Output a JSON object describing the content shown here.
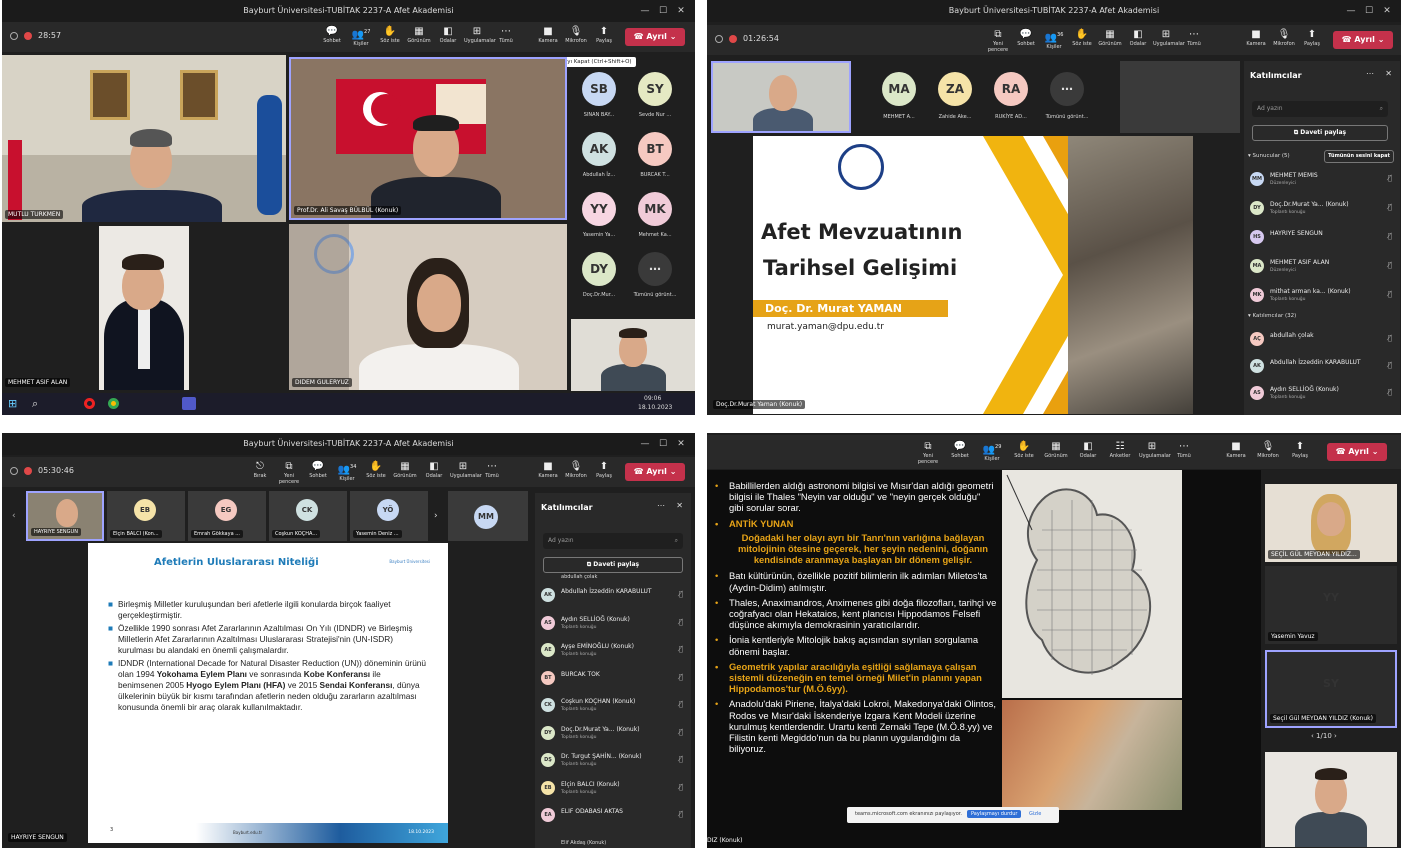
{
  "q1": {
    "title": "Bayburt Üniversitesi-TUBİTAK 2237-A Afet Akademisi",
    "timer": "28:57",
    "toolbar": [
      {
        "icon": "💬",
        "label": "Sohbet"
      },
      {
        "icon": "👥",
        "label": "Kişiler",
        "badge": "27"
      },
      {
        "icon": "✋",
        "label": "Söz iste"
      },
      {
        "icon": "▦",
        "label": "Görünüm"
      },
      {
        "icon": "◧",
        "label": "Odalar"
      },
      {
        "icon": "⊞",
        "label": "Uygulamalar"
      },
      {
        "icon": "⋯",
        "label": "Tümü"
      },
      {
        "icon": "■",
        "label": "Kamera"
      },
      {
        "icon": "🎙",
        "label": "Mikrofon"
      },
      {
        "icon": "⬆",
        "label": "Paylaş"
      }
    ],
    "leave": "Ayrıl",
    "tooltip": "Kamerayı Kapat (Ctrl+Shift+O)",
    "tiles": [
      {
        "name": "MUTLU TURKMEN"
      },
      {
        "name": "Prof.Dr. Ali Savaş BÜLBÜL (Konuk)"
      },
      {
        "name": "MEHMET ASIF ALAN"
      },
      {
        "name": "DIDEM GULERYUZ"
      }
    ],
    "avatars": [
      {
        "initials": "SB",
        "name": "SINAN BAY...",
        "color": "#c7d8f3"
      },
      {
        "initials": "SY",
        "name": "Sevde Nur ...",
        "color": "#e5e9c3"
      },
      {
        "initials": "AK",
        "name": "Abdullah İz...",
        "color": "#cfe1e1"
      },
      {
        "initials": "BT",
        "name": "BURCAK T...",
        "color": "#f5c9c1"
      },
      {
        "initials": "YY",
        "name": "Yasemin Ya...",
        "color": "#f7d6e2"
      },
      {
        "initials": "MK",
        "name": "Mehmet Ka...",
        "color": "#f0cbd8"
      },
      {
        "initials": "DY",
        "name": "Doç.Dr.Mur...",
        "color": "#dbe7c8"
      },
      {
        "initials": "⋯",
        "name": "Tümünü görünt...",
        "color": "#3a3a3a"
      }
    ],
    "taskbar_time": "09:06",
    "taskbar_date": "18.10.2023"
  },
  "q2": {
    "title": "Bayburt Üniversitesi-TUBİTAK 2237-A Afet Akademisi",
    "timer": "01:26:54",
    "toolbar": [
      {
        "icon": "⧉",
        "label": "Yeni pencere"
      },
      {
        "icon": "💬",
        "label": "Sohbet"
      },
      {
        "icon": "👥",
        "label": "Kişiler",
        "badge": "36"
      },
      {
        "icon": "✋",
        "label": "Söz iste"
      },
      {
        "icon": "▦",
        "label": "Görünüm"
      },
      {
        "icon": "◧",
        "label": "Odalar"
      },
      {
        "icon": "⊞",
        "label": "Uygulamalar"
      },
      {
        "icon": "⋯",
        "label": "Tümü"
      },
      {
        "icon": "■",
        "label": "Kamera"
      },
      {
        "icon": "🎙",
        "label": "Mikrofon"
      },
      {
        "icon": "⬆",
        "label": "Paylaş"
      }
    ],
    "leave": "Ayrıl",
    "avatars": [
      {
        "initials": "MA",
        "name": "MEHMET A...",
        "color": "#dbe7c8"
      },
      {
        "initials": "ZA",
        "name": "Zahide Ake...",
        "color": "#f5e3a8"
      },
      {
        "initials": "RA",
        "name": "RUKİYE AD...",
        "color": "#f5c9c1"
      },
      {
        "initials": "⋯",
        "name": "Tümünü görünt...",
        "color": "#3a3a3a"
      }
    ],
    "mm_initials": "MM",
    "slide": {
      "title1": "Afet Mevzuatının",
      "title2": "Tarihsel Gelişimi",
      "author": "Doç. Dr. Murat YAMAN",
      "email": "murat.yaman@dpu.edu.tr"
    },
    "presenter_label": "Doç.Dr.Murat Yaman (Konuk)",
    "panel": {
      "title": "Katılımcılar",
      "search": "Ad yazın",
      "invite": "Daveti paylaş",
      "presenters_label": "Sunucular (5)",
      "mute_all": "Tümünün sesini kapat",
      "presenters": [
        {
          "initials": "MM",
          "name": "MEHMET MEMIS",
          "role": "Düzenleyici",
          "color": "#c7d8f3"
        },
        {
          "initials": "DY",
          "name": "Doç.Dr.Murat Ya... (Konuk)",
          "role": "Toplantı konuğu",
          "color": "#dbe7c8"
        },
        {
          "initials": "HS",
          "name": "HAYRIYE SENGUN",
          "role": "",
          "color": "#d6c8ef"
        },
        {
          "initials": "MA",
          "name": "MEHMET ASIF ALAN",
          "role": "Düzenleyici",
          "color": "#dbe7c8"
        },
        {
          "initials": "MK",
          "name": "mithat arman ka... (Konuk)",
          "role": "Toplantı konuğu",
          "color": "#f0cbd8"
        }
      ],
      "attendees_label": "Katılımcılar (32)",
      "attendees": [
        {
          "initials": "AÇ",
          "name": "abdullah çolak",
          "role": "",
          "color": "#f5c9c1"
        },
        {
          "initials": "AK",
          "name": "Abdullah İzzeddin KARABULUT",
          "role": "",
          "color": "#cfe1e1"
        },
        {
          "initials": "AS",
          "name": "Aydın SELLİOĞ (Konuk)",
          "role": "Toplantı konuğu",
          "color": "#f0cbd8"
        }
      ]
    }
  },
  "q3": {
    "title": "Bayburt Üniversitesi-TUBİTAK 2237-A Afet Akademisi",
    "timer": "05:30:46",
    "toolbar": [
      {
        "icon": "⎋",
        "label": "Bırak"
      },
      {
        "icon": "⧉",
        "label": "Yeni pencere"
      },
      {
        "icon": "💬",
        "label": "Sohbet"
      },
      {
        "icon": "👥",
        "label": "Kişiler",
        "badge": "34"
      },
      {
        "icon": "✋",
        "label": "Söz iste"
      },
      {
        "icon": "▦",
        "label": "Görünüm"
      },
      {
        "icon": "◧",
        "label": "Odalar"
      },
      {
        "icon": "⊞",
        "label": "Uygulamalar"
      },
      {
        "icon": "⋯",
        "label": "Tümü"
      },
      {
        "icon": "■",
        "label": "Kamera"
      },
      {
        "icon": "🎙",
        "label": "Mikrofon"
      },
      {
        "icon": "⬆",
        "label": "Paylaş"
      }
    ],
    "leave": "Ayrıl",
    "strip": [
      {
        "initials": "",
        "name": "HAYRIYE SENGUN",
        "color": ""
      },
      {
        "initials": "EB",
        "name": "Elçin BALCI (Kon...",
        "color": "#f5e3a8"
      },
      {
        "initials": "EG",
        "name": "Emrah Gökkaya ...",
        "color": "#f5c9c1"
      },
      {
        "initials": "CK",
        "name": "Coşkun KOÇHA...",
        "color": "#cfe1e1"
      },
      {
        "initials": "YÖ",
        "name": "Yasemin Deniz ...",
        "color": "#c7d8f3"
      }
    ],
    "mm_initials": "MM",
    "slide": {
      "heading": "Afetlerin Uluslararası Niteliği",
      "logo_text": "Bayburt Üniversitesi",
      "bullets": [
        "Birleşmiş Milletler kuruluşundan beri afetlerle ilgili konularda birçok faaliyet gerçekleştirmiştir.",
        "Özellikle 1990 sonrası Afet Zararlarının Azaltılması On Yılı (IDNDR) ve Birleşmiş Milletlerin Afet Zararlarının Azaltılması Uluslararası Stratejisi'nin (UN-ISDR) kurulması bu alandaki en önemli çalışmalardır."
      ],
      "b3_part1": "IDNDR (International Decade for Natural Disaster Reduction (UN)) döneminin ürünü olan 1994 ",
      "b3_bold1": "Yokohama Eylem Planı",
      "b3_part2": " ve sonrasında ",
      "b3_bold2": "Kobe Konferansı",
      "b3_part3": " ile benimsenen 2005 ",
      "b3_bold3": "Hyogo Eylem Planı (HFA)",
      "b3_part4": " ve 2015 ",
      "b3_bold4": "Sendai Konferansı",
      "b3_part5": ", dünya ülkelerinin büyük bir kısmı tarafından afetlerin neden olduğu zararların azaltılması konusunda önemli bir araç olarak kullanılmaktadır.",
      "page_num": "3",
      "footer_left": "Bayburt.edu.tr",
      "footer_date": "18.10.2023"
    },
    "presenter_label": "HAYRIYE SENGUN",
    "panel": {
      "title": "Katılımcılar",
      "search": "Ad yazın",
      "invite": "Daveti paylaş",
      "cut_top": "abdullah çolak",
      "rows": [
        {
          "initials": "AK",
          "name": "Abdullah İzzeddin KARABULUT",
          "role": "",
          "color": "#cfe1e1"
        },
        {
          "initials": "AS",
          "name": "Aydın SELLİOĞ (Konuk)",
          "role": "Toplantı konuğu",
          "color": "#f0cbd8"
        },
        {
          "initials": "AE",
          "name": "Ayşe EMİNOĞLU (Konuk)",
          "role": "Toplantı konuğu",
          "color": "#dbe7c8"
        },
        {
          "initials": "BT",
          "name": "BURCAK TOK",
          "role": "",
          "color": "#f5c9c1"
        },
        {
          "initials": "CK",
          "name": "Coşkun KOÇHAN (Konuk)",
          "role": "Toplantı konuğu",
          "color": "#cfe1e1"
        },
        {
          "initials": "DY",
          "name": "Doç.Dr.Murat Ya... (Konuk)",
          "role": "Toplantı konuğu",
          "color": "#dbe7c8"
        },
        {
          "initials": "DŞ",
          "name": "Dr. Turgut ŞAHİN... (Konuk)",
          "role": "Toplantı konuğu",
          "color": "#dbe7c8"
        },
        {
          "initials": "EB",
          "name": "Elçin BALCI (Konuk)",
          "role": "Toplantı konuğu",
          "color": "#f5e3a8"
        },
        {
          "initials": "EA",
          "name": "ELIF ODABASI AKTAS",
          "role": "",
          "color": "#f0cbd8"
        }
      ],
      "cut_bottom": "Elif Akdaş (Konuk)"
    }
  },
  "q4": {
    "toolbar": [
      {
        "icon": "⧉",
        "label": "Yeni pencere"
      },
      {
        "icon": "💬",
        "label": "Sohbet"
      },
      {
        "icon": "👥",
        "label": "Kişiler",
        "badge": "29"
      },
      {
        "icon": "✋",
        "label": "Söz iste"
      },
      {
        "icon": "▦",
        "label": "Görünüm"
      },
      {
        "icon": "◧",
        "label": "Odalar"
      },
      {
        "icon": "☷",
        "label": "Anketler"
      },
      {
        "icon": "⊞",
        "label": "Uygulamalar"
      },
      {
        "icon": "⋯",
        "label": "Tümü"
      },
      {
        "icon": "■",
        "label": "Kamera"
      },
      {
        "icon": "🎙",
        "label": "Mikrofon"
      },
      {
        "icon": "⬆",
        "label": "Paylaş"
      }
    ],
    "leave": "Ayrıl",
    "slide_p1": "Babillilerden aldığı astronomi bilgisi ve Mısır'dan aldığı geometri bilgisi ile Thales \"Neyin var olduğu\" ve \"neyin gerçek olduğu\" gibi sorular sorar.",
    "slide_heading": "ANTİK YUNAN",
    "slide_quote": "Doğadaki her olayı ayrı bir Tanrı'nın varlığına bağlayan mitolojinin ötesine geçerek, her şeyin nedenini, doğanın kendisinde aranmaya başlayan bir dönem gelişir.",
    "slide_p2": "Batı kültürünün, özellikle pozitif bilimlerin ilk adımları Miletos'ta (Aydın-Didim) atılmıştır.",
    "slide_p3": "Thales, Anaximandros, Anximenes gibi doğa filozofları, tarihçi ve coğrafyacı olan Hekataios, kent plancısı Hippodamos Felsefi düşünce akımıyla demokrasinin yaratıcılarıdır.",
    "slide_p4": "İonia kentleriyle Mitolojik bakış açısından sıyrılan sorgulama dönemi başlar.",
    "slide_quote2": "Geometrik yapılar aracılığıyla eşitliği sağlamaya çalışan sistemli düzeneğin en temel örneği Milet'in planını yapan Hippodamos'tur (M.Ö.6yy).",
    "slide_p5": "Anadolu'daki Piriene, İtalya'daki Lokroi, Makedonya'daki Olintos, Rodos ve Mısır'daki İskenderiye Izgara Kent Modeli üzerine kurulmuş kentlerdendir. Urartu kenti Zernaki Tepe (M.Ö.8.yy) ve Filistin kenti Megiddo'nun da bu planın uygulandığını da biliyoruz.",
    "share_msg": "teams.microsoft.com ekranınızı paylaşıyor.",
    "share_stop": "Paylaşmayı durdur",
    "share_hide": "Gizle",
    "bottom_label": "DIZ (Konuk)",
    "side": [
      {
        "name": "SEÇİL GÜL MEYDAN YILDIZ..."
      },
      {
        "initials": "YY",
        "name": "Yasemin Yavuz",
        "color": "#f7d6e2"
      },
      {
        "initials": "SY",
        "name": "Seçil Gül MEYDAN YILDIZ (Konuk)",
        "color": "#e5e9c3"
      }
    ],
    "pager": "1/10"
  }
}
